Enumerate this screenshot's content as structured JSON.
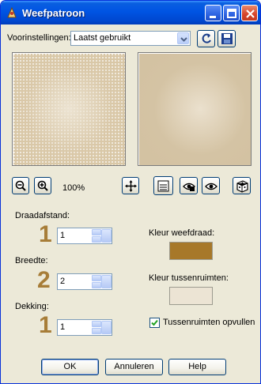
{
  "window": {
    "title": "Weefpatroon",
    "controls": [
      "minimize",
      "maximize",
      "close"
    ]
  },
  "presets": {
    "label": "Voorinstellingen:",
    "value": "Laatst gebruikt",
    "apply_icon": "reset-arrow-icon",
    "save_icon": "floppy-save-icon"
  },
  "zoom": {
    "level": "100%"
  },
  "fields": {
    "draadafstand": {
      "label": "Draadafstand:",
      "number": "1",
      "value": "1"
    },
    "breedte": {
      "label": "Breedte:",
      "number": "2",
      "value": "2"
    },
    "dekking": {
      "label": "Dekking:",
      "number": "1",
      "value": "1"
    }
  },
  "colors": {
    "weefdraad_label": "Kleur weefdraad:",
    "weefdraad_color": "#a77829",
    "tussenruimten_label": "Kleur tussenruimten:",
    "tussenruimten_color": "#ece4d4"
  },
  "checkbox": {
    "label": "Tussenruimten opvullen",
    "checked": true
  },
  "buttons": {
    "ok": "OK",
    "cancel": "Annuleren",
    "help": "Help"
  }
}
